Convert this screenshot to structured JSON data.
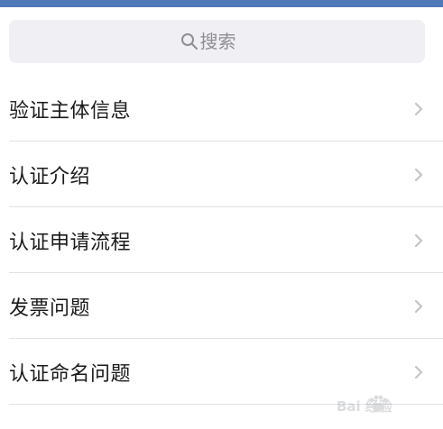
{
  "colors": {
    "top_bar": "#4f79b8",
    "search_bg": "#efeff4",
    "placeholder": "#8e8e93",
    "text": "#1a1a1a",
    "chevron": "#c4c4c9",
    "divider": "#e2e2e6"
  },
  "search": {
    "placeholder": "搜索",
    "icon": "search-icon"
  },
  "list": {
    "items": [
      {
        "label": "验证主体信息",
        "icon": "chevron-right-icon"
      },
      {
        "label": "认证介绍",
        "icon": "chevron-right-icon"
      },
      {
        "label": "认证申请流程",
        "icon": "chevron-right-icon"
      },
      {
        "label": "发票问题",
        "icon": "chevron-right-icon"
      },
      {
        "label": "认证命名问题",
        "icon": "chevron-right-icon"
      }
    ]
  },
  "watermark": {
    "text": "Bai 经验",
    "icon": "baidu-paw-logo"
  }
}
